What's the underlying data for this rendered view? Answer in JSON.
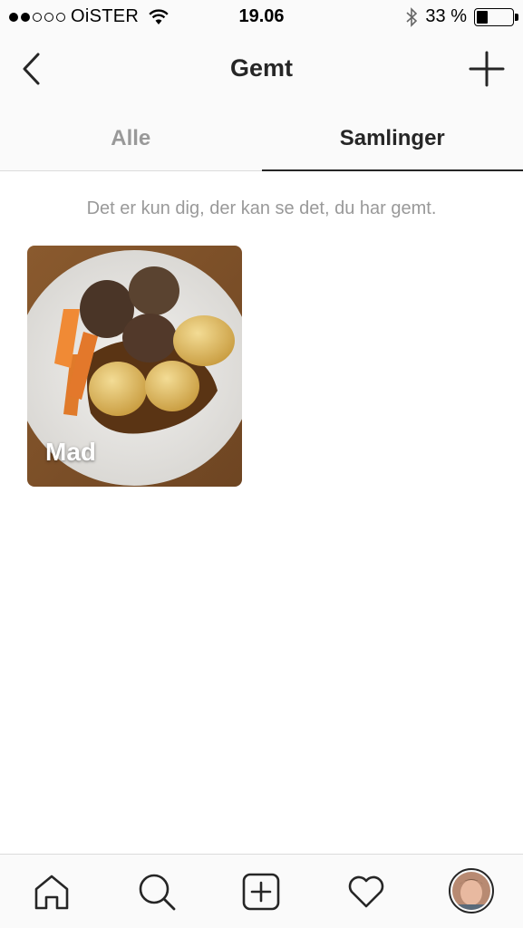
{
  "status_bar": {
    "carrier": "OiSTER",
    "time": "19.06",
    "battery_percent_label": "33 %",
    "battery_level": 0.33,
    "signal_bars_filled": 2,
    "signal_bars_total": 5
  },
  "nav": {
    "title": "Gemt",
    "back_icon": "chevron-left-icon",
    "add_icon": "plus-icon"
  },
  "tabs": [
    {
      "label": "Alle",
      "active": false
    },
    {
      "label": "Samlinger",
      "active": true
    }
  ],
  "notice": "Det er kun dig, der kan se det, du har gemt.",
  "collections": [
    {
      "name": "Mad"
    }
  ],
  "tab_bar": {
    "items": [
      "home-icon",
      "search-icon",
      "new-post-icon",
      "heart-icon",
      "profile-avatar"
    ]
  },
  "colors": {
    "text_primary": "#262626",
    "text_secondary": "#999999",
    "bar_background": "#fafafa",
    "divider": "#dbdbdb"
  }
}
